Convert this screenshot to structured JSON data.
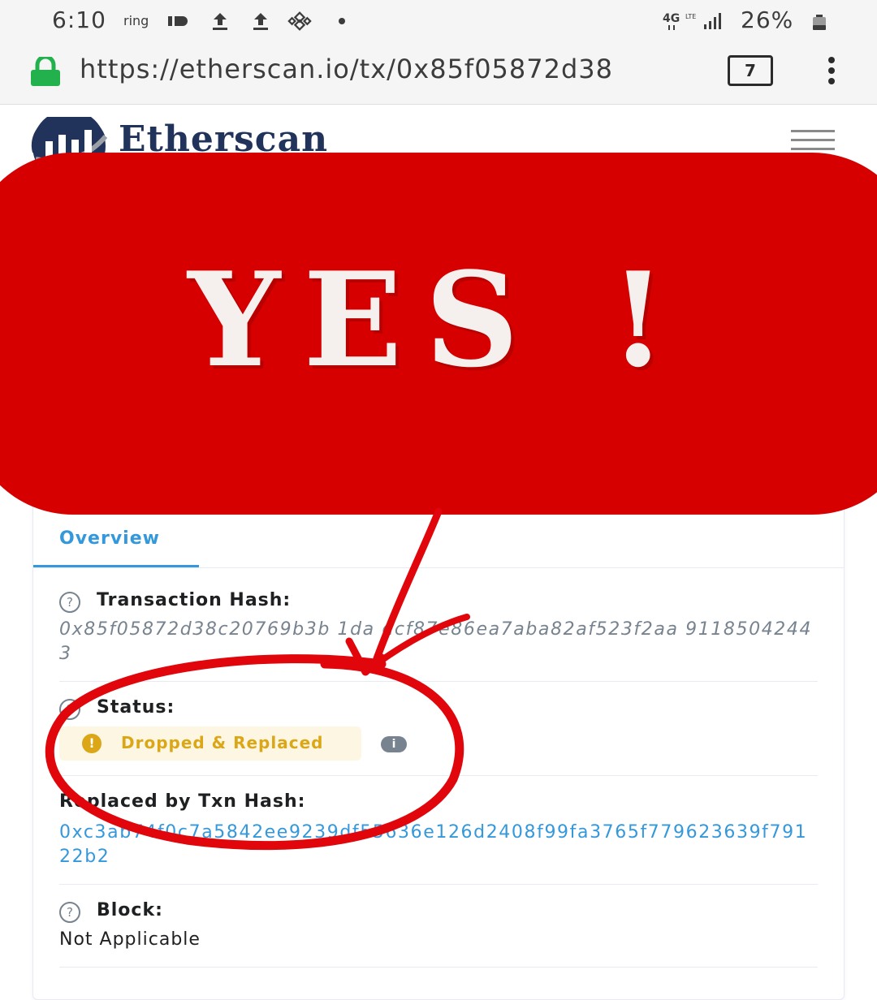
{
  "status_bar": {
    "time": "6:10",
    "carrier_app": "ring",
    "network": "4G",
    "battery": "26%"
  },
  "browser": {
    "url": "https://etherscan.io/tx/0x85f05872d38",
    "tab_count": "7"
  },
  "site": {
    "logo_text": "Etherscan"
  },
  "overlay": {
    "headline": "YES !",
    "banner_color": "#d60000"
  },
  "overview": {
    "tab_label": "Overview",
    "tx_hash_label": "Transaction Hash:",
    "tx_hash_value": "0x85f05872d38c20769b3b 1da dcf87e86ea7aba82af523f2aa 91185042443",
    "status_label": "Status:",
    "status_value": "Dropped & Replaced",
    "status_color": "#dba716",
    "replaced_label": "Replaced by Txn Hash:",
    "replaced_value": "0xc3ab74f0c7a5842ee9239df55636e126d2408f99fa3765f779623639f79122b2",
    "block_label": "Block:",
    "block_value": "Not Applicable"
  }
}
